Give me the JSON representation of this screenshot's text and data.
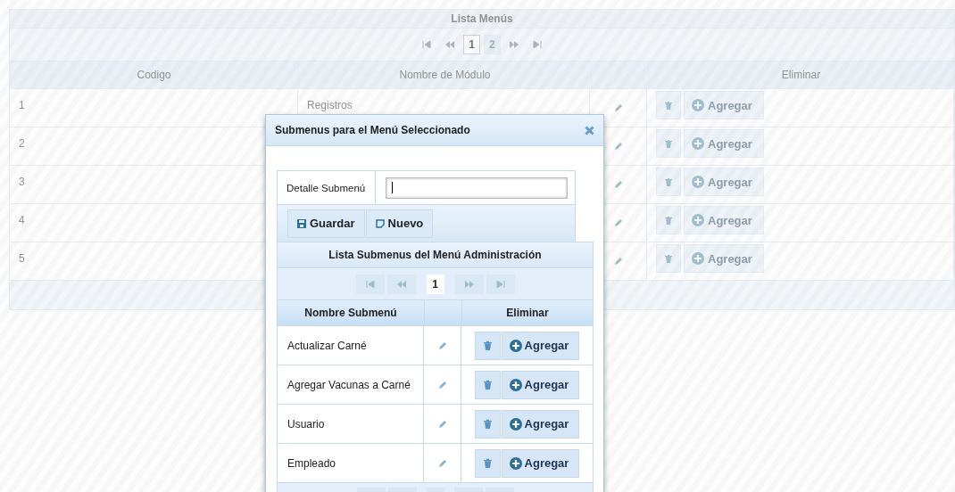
{
  "list_title": "Lista Menús",
  "pager": {
    "pages": [
      {
        "label": "1",
        "selected": true
      },
      {
        "label": "2",
        "selected": false
      }
    ]
  },
  "table": {
    "columns": [
      "Codigo",
      "Nombre de Módulo",
      "Eliminar"
    ],
    "rows": [
      {
        "code": "1",
        "name": "Registros",
        "add_label": "Agregar"
      },
      {
        "code": "2",
        "add_label": "Agregar"
      },
      {
        "code": "3",
        "add_label": "Agregar"
      },
      {
        "code": "4",
        "add_label": "Agregar"
      },
      {
        "code": "5",
        "add_label": "Agregar"
      }
    ]
  },
  "dialog": {
    "title": "Submenus para el Menú Seleccionado",
    "field_label": "Detalle Submenú",
    "buttons": [
      {
        "kind": "save",
        "label": "Guardar"
      },
      {
        "kind": "new",
        "label": "Nuevo"
      }
    ],
    "list_title": "Lista Submenus del Menú Administración",
    "pager": {
      "pages": [
        {
          "label": "1",
          "selected": true
        }
      ]
    },
    "columns": [
      "Nombre Submenú",
      "Eliminar"
    ],
    "rows": [
      {
        "name": "Actualizar Carné",
        "add_label": "Agregar"
      },
      {
        "name": "Agregar Vacunas a Carné",
        "add_label": "Agregar"
      },
      {
        "name": "Usuario",
        "add_label": "Agregar"
      },
      {
        "name": "Empleado",
        "add_label": "Agregar"
      }
    ]
  }
}
